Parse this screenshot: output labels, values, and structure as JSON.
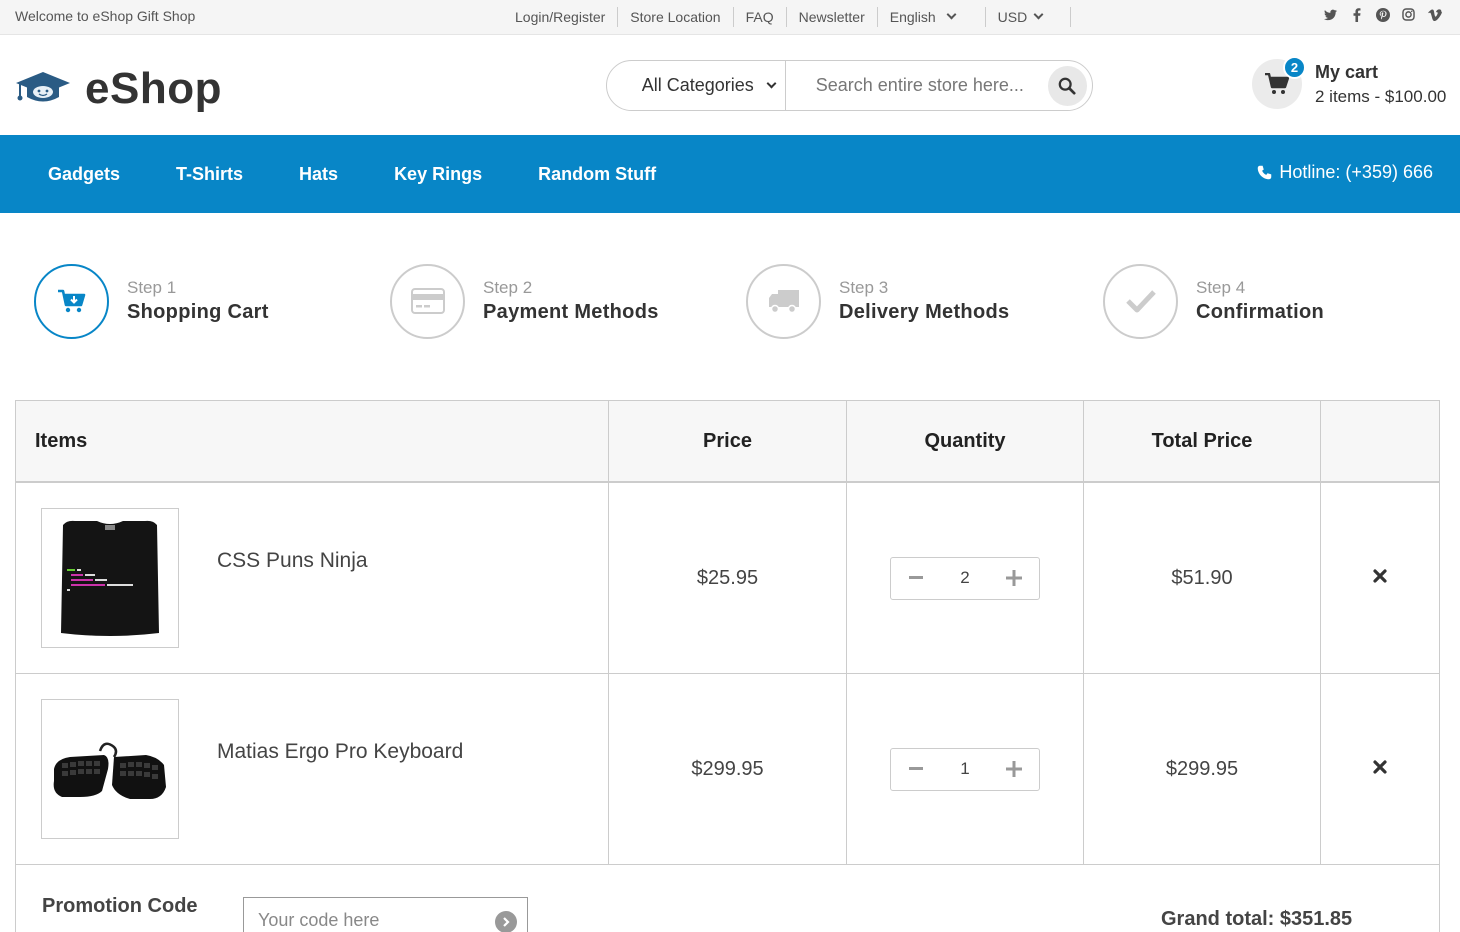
{
  "topbar": {
    "welcome": "Welcome to eShop Gift Shop",
    "links": [
      "Login/Register",
      "Store Location",
      "FAQ",
      "Newsletter"
    ],
    "language": "English",
    "currency": "USD",
    "social_icons": [
      "twitter-icon",
      "facebook-icon",
      "pinterest-icon",
      "instagram-icon",
      "vimeo-icon"
    ]
  },
  "header": {
    "logo_text": "eShop",
    "search": {
      "category": "All Categories",
      "placeholder": "Search entire store here..."
    },
    "cart": {
      "count": "2",
      "title": "My cart",
      "summary": "2 items - $100.00"
    }
  },
  "nav": {
    "items": [
      "Gadgets",
      "T-Shirts",
      "Hats",
      "Key Rings",
      "Random Stuff"
    ],
    "hotline": "Hotline: (+359) 666"
  },
  "steps": [
    {
      "step": "Step 1",
      "label": "Shopping Cart",
      "icon": "cart-icon",
      "active": true
    },
    {
      "step": "Step 2",
      "label": "Payment Methods",
      "icon": "credit-card-icon",
      "active": false
    },
    {
      "step": "Step 3",
      "label": "Delivery Methods",
      "icon": "truck-icon",
      "active": false
    },
    {
      "step": "Step 4",
      "label": "Confirmation",
      "icon": "checkmark-icon",
      "active": false
    }
  ],
  "cart_table": {
    "headers": [
      "Items",
      "Price",
      "Quantity",
      "Total Price"
    ],
    "rows": [
      {
        "name": "CSS Puns Ninja",
        "price": "$25.95",
        "quantity": "2",
        "total": "$51.90"
      },
      {
        "name": "Matias Ergo Pro Keyboard",
        "price": "$299.95",
        "quantity": "1",
        "total": "$299.95"
      }
    ]
  },
  "promo": {
    "label": "Promotion Code",
    "placeholder": "Your code here",
    "grand_total": "Grand total: $351.85"
  },
  "colors": {
    "accent": "#0886c7",
    "topbar_bg": "#f5f5f5",
    "border": "#cccccc"
  }
}
